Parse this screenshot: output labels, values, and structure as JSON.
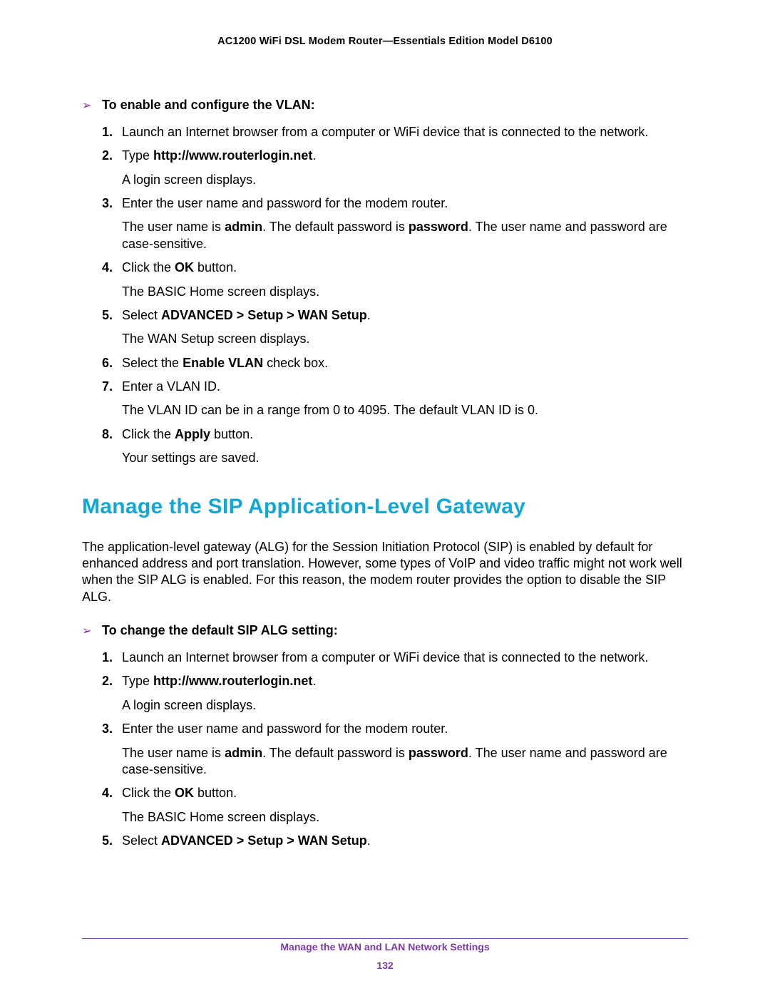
{
  "header": {
    "title": "AC1200 WiFi DSL Modem Router—Essentials Edition Model D6100"
  },
  "proc1": {
    "chev": "➢",
    "title": "To enable and configure the VLAN:",
    "s1": {
      "n": "1.",
      "t": "Launch an Internet browser from a computer or WiFi device that is connected to the network."
    },
    "s2": {
      "n": "2.",
      "pre": "Type ",
      "b": "http://www.routerlogin.net",
      "post": ".",
      "t2": "A login screen displays."
    },
    "s3": {
      "n": "3.",
      "t1": "Enter the user name and password for the modem router.",
      "p2a": "The user name is ",
      "p2b": "admin",
      "p2c": ". The default password is ",
      "p2d": "password",
      "p2e": ". The user name and password are case-sensitive."
    },
    "s4": {
      "n": "4.",
      "a": "Click the ",
      "b": "OK",
      "c": " button.",
      "t2": "The BASIC Home screen displays."
    },
    "s5": {
      "n": "5.",
      "a": "Select ",
      "b": "ADVANCED > Setup > WAN Setup",
      "c": ".",
      "t2": "The WAN Setup screen displays."
    },
    "s6": {
      "n": "6.",
      "a": "Select the ",
      "b": "Enable VLAN",
      "c": " check box."
    },
    "s7": {
      "n": "7.",
      "t1": "Enter a VLAN ID.",
      "t2": "The VLAN ID can be in a range from 0 to 4095. The default VLAN ID is 0."
    },
    "s8": {
      "n": "8.",
      "a": "Click the ",
      "b": "Apply",
      "c": " button.",
      "t2": "Your settings are saved."
    }
  },
  "section": {
    "title": "Manage the SIP Application-Level Gateway",
    "intro": "The application-level gateway (ALG) for the Session Initiation Protocol (SIP) is enabled by default for enhanced address and port translation. However, some types of VoIP and video traffic might not work well when the SIP ALG is enabled. For this reason, the modem router provides the option to disable the SIP ALG."
  },
  "proc2": {
    "chev": "➢",
    "title": "To change the default SIP ALG setting:",
    "s1": {
      "n": "1.",
      "t": "Launch an Internet browser from a computer or WiFi device that is connected to the network."
    },
    "s2": {
      "n": "2.",
      "pre": "Type ",
      "b": "http://www.routerlogin.net",
      "post": ".",
      "t2": "A login screen displays."
    },
    "s3": {
      "n": "3.",
      "t1": "Enter the user name and password for the modem router.",
      "p2a": "The user name is ",
      "p2b": "admin",
      "p2c": ". The default password is ",
      "p2d": "password",
      "p2e": ". The user name and password are case-sensitive."
    },
    "s4": {
      "n": "4.",
      "a": "Click the ",
      "b": "OK",
      "c": " button.",
      "t2": "The BASIC Home screen displays."
    },
    "s5": {
      "n": "5.",
      "a": "Select ",
      "b": "ADVANCED > Setup > WAN Setup",
      "c": "."
    }
  },
  "footer": {
    "title": "Manage the WAN and LAN Network Settings",
    "page": "132"
  }
}
